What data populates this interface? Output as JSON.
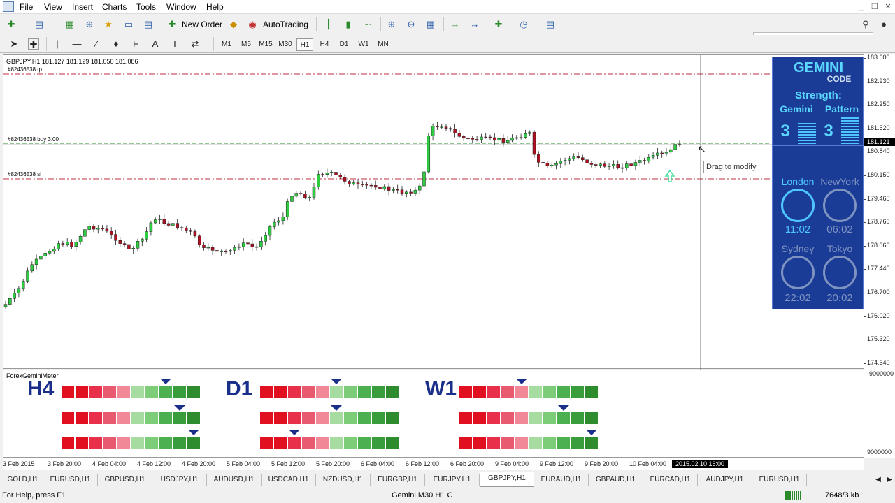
{
  "menu": {
    "items": [
      "File",
      "View",
      "Insert",
      "Charts",
      "Tools",
      "Window",
      "Help"
    ]
  },
  "toolbar": {
    "new_order": "New Order",
    "autotrading": "AutoTrading",
    "search_placeholder": ""
  },
  "timeframes": {
    "items": [
      "M1",
      "M5",
      "M15",
      "M30",
      "H1",
      "H4",
      "D1",
      "W1",
      "MN"
    ],
    "active": "H1"
  },
  "chart": {
    "header": "GBPJPY,H1  181.127 181.129 181.050 181.086",
    "tp_label": "#82436538 tp",
    "order_label": "#82436538 buy 3.00",
    "sl_label": "#82436538 sl",
    "tooltip": "Drag to modify",
    "price_tag": "181.121",
    "date_tag": "2015.02.10 16:00",
    "y_labels": [
      "183.600",
      "182.930",
      "182.250",
      "181.520",
      "180.840",
      "180.150",
      "179.460",
      "178.760",
      "178.060",
      "177.440",
      "176.700",
      "176.020",
      "175.320",
      "174.640"
    ],
    "x_labels": [
      "3 Feb 2015",
      "3 Feb 20:00",
      "4 Feb 04:00",
      "4 Feb 12:00",
      "4 Feb 20:00",
      "5 Feb 04:00",
      "5 Feb 12:00",
      "5 Feb 20:00",
      "6 Feb 04:00",
      "6 Feb 12:00",
      "6 Feb 20:00",
      "9 Feb 04:00",
      "9 Feb 12:00",
      "9 Feb 20:00",
      "10 Feb 04:00"
    ],
    "ind_y_labels": [
      "-9000000",
      "9000000"
    ]
  },
  "gemini_panel": {
    "title": "GEMINI",
    "subtitle": "CODE",
    "strength_label": "Strength:",
    "col1": "Gemini",
    "col2": "Pattern",
    "val1": "3",
    "val2": "3",
    "clocks": [
      {
        "city": "London",
        "time": "11:02"
      },
      {
        "city": "NewYork",
        "time": "06:02"
      },
      {
        "city": "Sydney",
        "time": "22:02"
      },
      {
        "city": "Tokyo",
        "time": "20:02"
      }
    ]
  },
  "indicator": {
    "name": "ForexGeminiMeter",
    "labels": [
      "H4",
      "D1",
      "W1"
    ],
    "colors": [
      "#e01020",
      "#e01020",
      "#e8304a",
      "#e85a70",
      "#f08898",
      "#a6dca0",
      "#7ccc78",
      "#4caf50",
      "#3a9d3c",
      "#2e8b2e"
    ],
    "arrows": [
      [
        7,
        8,
        9
      ],
      [
        5,
        5,
        2
      ],
      [
        4,
        7,
        9
      ]
    ]
  },
  "tabs": {
    "items": [
      "GOLD,H1",
      "EURUSD,H1",
      "GBPUSD,H1",
      "USDJPY,H1",
      "AUDUSD,H1",
      "USDCAD,H1",
      "NZDUSD,H1",
      "EURGBP,H1",
      "EURJPY,H1",
      "GBPJPY,H1",
      "EURAUD,H1",
      "GBPAUD,H1",
      "EURCAD,H1",
      "AUDJPY,H1",
      "EURUSD,H1"
    ],
    "active": "GBPJPY,H1"
  },
  "status": {
    "help": "For Help, press F1",
    "profile": "Gemini M30 H1 C",
    "traffic": "7648/3 kb"
  }
}
